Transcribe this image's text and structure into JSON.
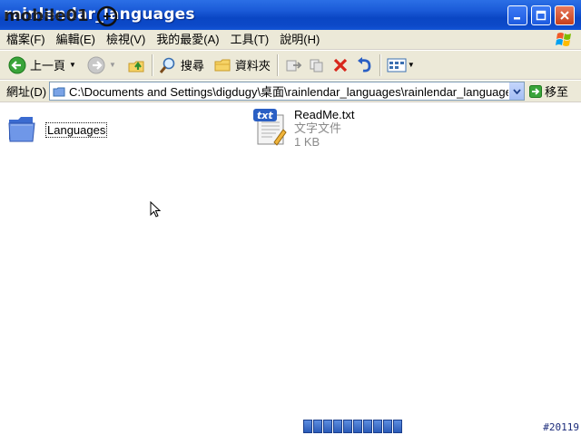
{
  "window": {
    "title": "rainlendar_languages",
    "watermark": "mobile01"
  },
  "menubar": {
    "items": [
      "檔案(F)",
      "編輯(E)",
      "檢視(V)",
      "我的最愛(A)",
      "工具(T)",
      "說明(H)"
    ]
  },
  "toolbar": {
    "back_label": "上一頁",
    "search_label": "搜尋",
    "folders_label": "資料夾"
  },
  "addressbar": {
    "label": "網址(D)",
    "path": "C:\\Documents and Settings\\digdugy\\桌面\\rainlendar_languages\\rainlendar_languages",
    "go_label": "移至"
  },
  "files": [
    {
      "name": "Languages",
      "kind": "folder"
    },
    {
      "name": "ReadMe.txt",
      "type": "文字文件",
      "size": "1 KB",
      "kind": "text"
    }
  ],
  "footer": {
    "stamp": "#20119"
  },
  "colors": {
    "titlebar": "#0a46c4",
    "chrome": "#ece9d8",
    "accent": "#2b6fe6"
  }
}
